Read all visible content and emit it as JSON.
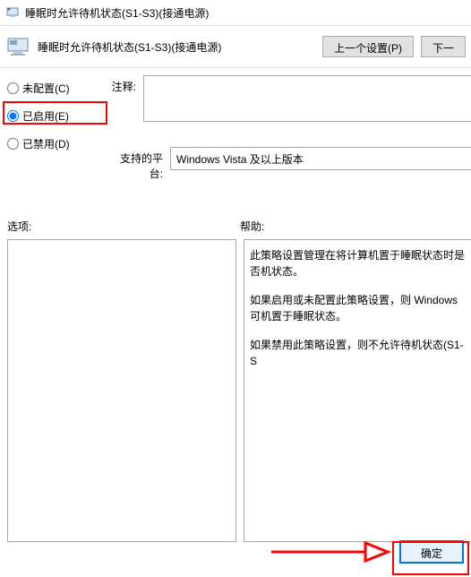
{
  "window": {
    "title": "睡眠时允许待机状态(S1-S3)(接通电源)"
  },
  "header": {
    "title": "睡眠时允许待机状态(S1-S3)(接通电源)",
    "prev_button": "上一个设置(P)",
    "next_button": "下一"
  },
  "radios": {
    "not_configured": "未配置(C)",
    "enabled": "已启用(E)",
    "disabled": "已禁用(D)"
  },
  "labels": {
    "comment": "注释:",
    "platform": "支持的平台:",
    "options": "选项:",
    "help": "帮助:"
  },
  "platform_text": "Windows Vista 及以上版本",
  "help_text": {
    "p1": "此策略设置管理在将计算机置于睡眠状态时是否机状态。",
    "p2": "如果启用或未配置此策略设置，则 Windows 可机置于睡眠状态。",
    "p3": "如果禁用此策略设置，则不允许待机状态(S1-S"
  },
  "buttons": {
    "ok": "确定"
  }
}
